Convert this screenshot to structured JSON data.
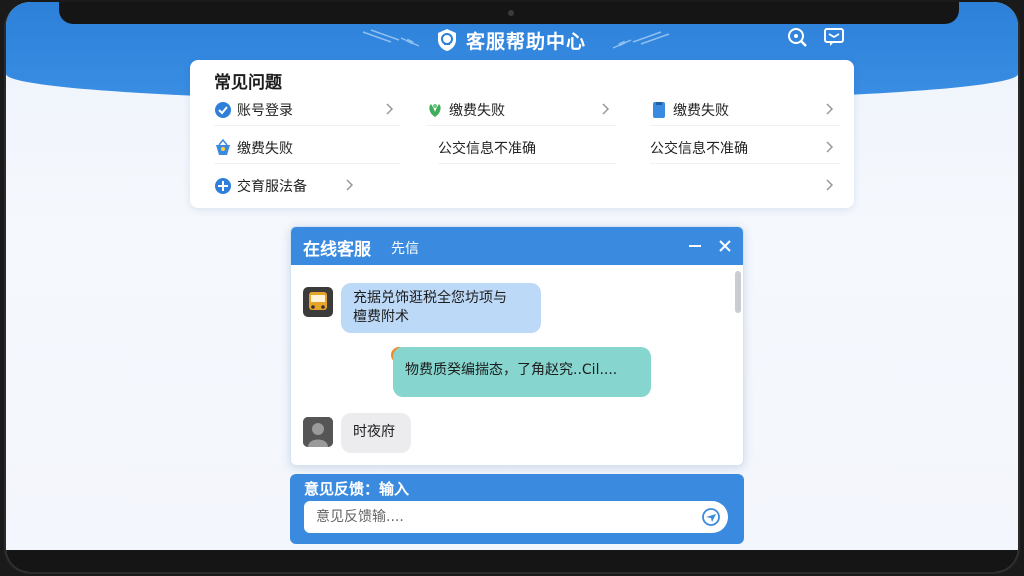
{
  "header": {
    "title": "客服帮助中心",
    "icons": [
      "shield-icon",
      "search-icon",
      "message-icon"
    ]
  },
  "faq": {
    "title": "常见问题",
    "items": [
      {
        "label": "账号登录",
        "icon": "check-circle-icon"
      },
      {
        "label": "缴费失败",
        "icon": "leaf-icon"
      },
      {
        "label": "缴费失败",
        "icon": "document-icon"
      },
      {
        "label": "缴费失败",
        "icon": "basket-icon"
      },
      {
        "label": "公交信息不准确",
        "icon": ""
      },
      {
        "label": "公交信息不准确",
        "icon": ""
      },
      {
        "label": "交育服法备",
        "icon": "plus-circle-icon"
      },
      {
        "label": "",
        "icon": ""
      },
      {
        "label": "",
        "icon": ""
      }
    ]
  },
  "chat": {
    "title": "在线客服",
    "subtitle": "先信",
    "messages": [
      {
        "from": "agent",
        "text_line1": "充据兑饰逛税全您坊项与",
        "text_line2": "檀费附术"
      },
      {
        "from": "user",
        "text": "物费质癸编揣态，了角赵究..Cil...."
      },
      {
        "from": "other",
        "text": "时夜府"
      }
    ]
  },
  "feedback": {
    "label": "意见反馈：输入",
    "placeholder": "意见反馈输...."
  },
  "colors": {
    "primary": "#3a8be0",
    "bubble_in": "#bcd9f7",
    "bubble_out": "#86d6cf",
    "bubble_gray": "#ececee"
  }
}
